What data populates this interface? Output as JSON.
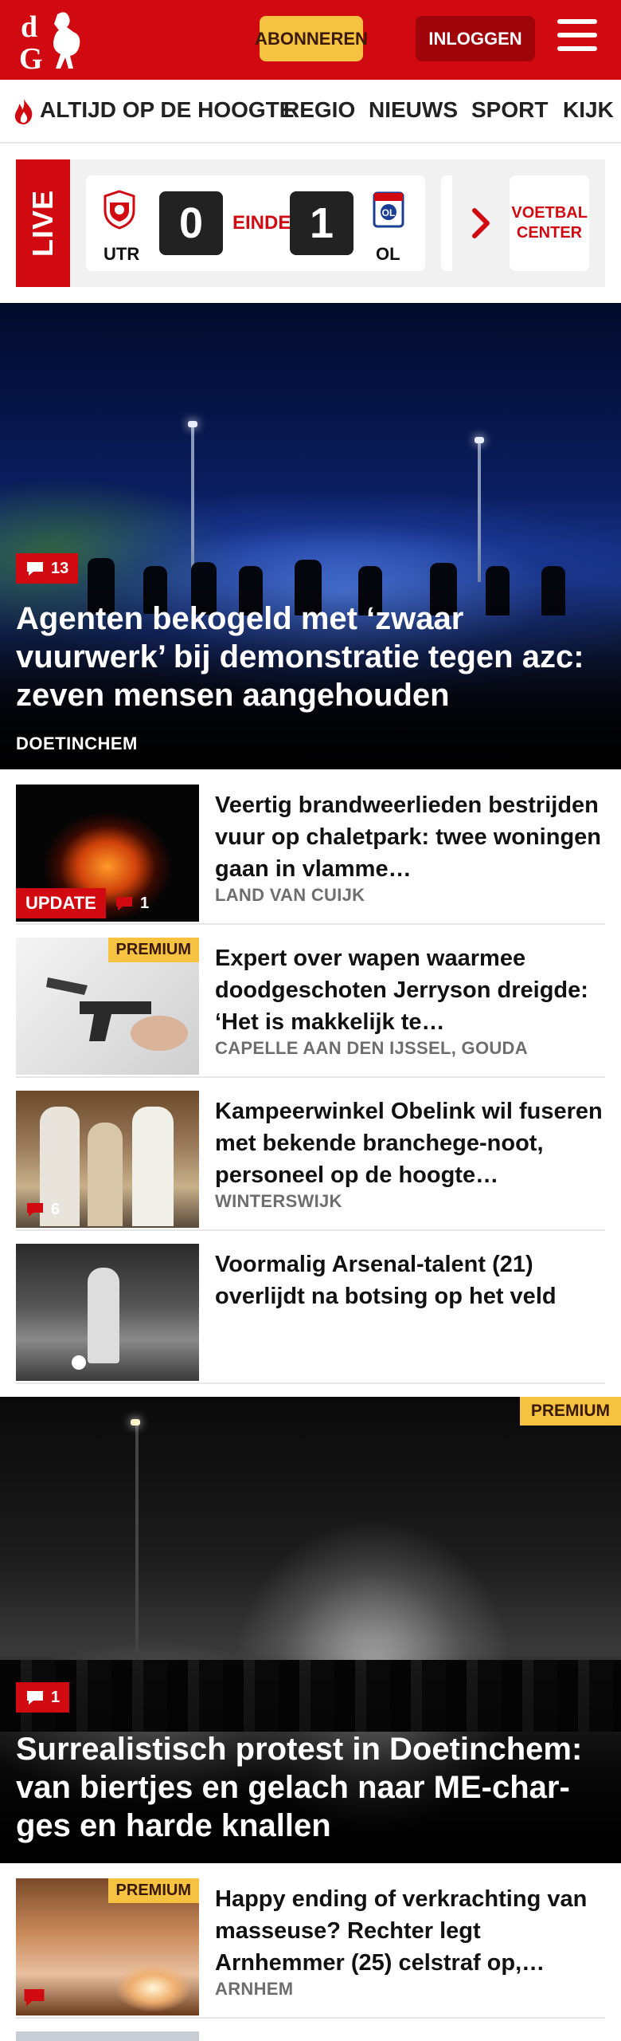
{
  "header": {
    "logo_text": "dG",
    "subscribe_label": "ABONNEREN",
    "login_label": "INLOGGEN",
    "brand_color": "#d10a11",
    "accent_color": "#f5c242"
  },
  "nav": {
    "items": [
      {
        "label": "ALTIJD OP DE HOOGTE",
        "icon": "flame-icon"
      },
      {
        "label": "REGIO"
      },
      {
        "label": "NIEUWS"
      },
      {
        "label": "SPORT"
      },
      {
        "label": "KIJK"
      }
    ]
  },
  "live": {
    "label": "LIVE",
    "match": {
      "home_team": "UTR",
      "home_score": "0",
      "status": "EINDE",
      "away_score": "1",
      "away_team": "OL"
    },
    "center_label": "VOETBAL CENTER"
  },
  "hero": {
    "comments": "13",
    "title": "Agenten bekogeld met ‘zwaar vuurwerk’ bij demonstratie tegen azc: zeven mensen aangehouden",
    "location": "DOETINCHEM"
  },
  "articles": [
    {
      "title": "Veertig brandweerlieden bestrijden vuur op chaletpark: twee woningen gaan in vlamme…",
      "location": "LAND VAN CUIJK",
      "tag": "UPDATE",
      "comments": "1"
    },
    {
      "title": "Expert over wapen waarmee doodgeschoten Jerryson dreigde: ‘Het is makkelijk te…",
      "location": "CAPELLE AAN DEN IJSSEL, GOUDA",
      "tag": "PREMIUM"
    },
    {
      "title": "Kampeerwinkel Obelink wil fuseren met bekende branchege-noot, personeel op de hoogte…",
      "location": "WINTERSWIJK",
      "comments": "6"
    },
    {
      "title": "Voormalig Arsenal-talent (21) overlijdt na botsing op het veld",
      "location": ""
    }
  ],
  "hero2": {
    "tag": "PREMIUM",
    "comments": "1",
    "title": "Surrealistisch protest in Doetinchem: van biertjes en gelach naar ME-char-ges en harde knallen"
  },
  "article_bottom": {
    "title": "Happy ending of verkrachting van masseuse? Rechter legt Arnhemmer (25) celstraf op,…",
    "location": "ARNHEM",
    "tag": "PREMIUM"
  }
}
